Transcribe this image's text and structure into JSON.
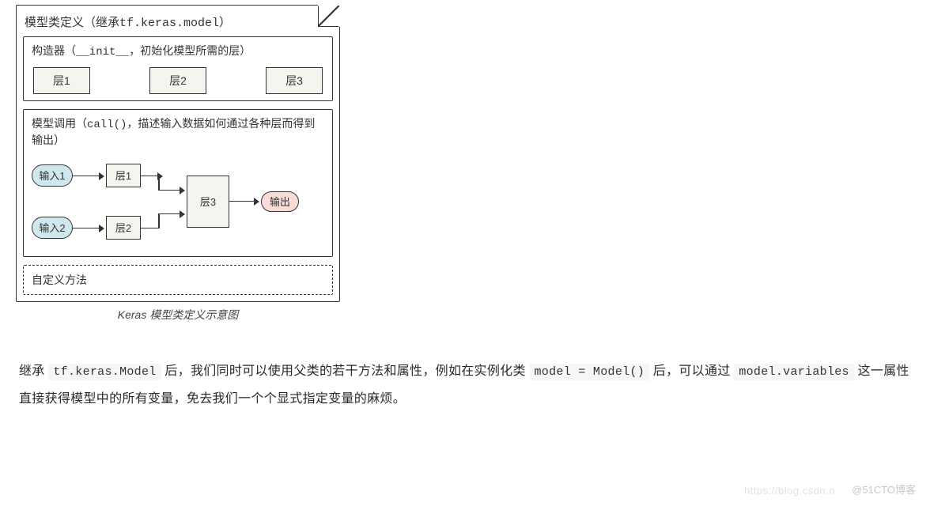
{
  "diagram": {
    "outer_title_pre": "模型类定义（继承",
    "outer_title_code": "tf.keras.model",
    "outer_title_post": "）",
    "constructor": {
      "label_pre": "构造器（",
      "label_code": "__init__",
      "label_post": "，初始化模型所需的层）",
      "layers": [
        "层1",
        "层2",
        "层3"
      ]
    },
    "call": {
      "label_pre": "模型调用（",
      "label_code": "call()",
      "label_post": "，描述输入数据如何通过各种层而得到输出）",
      "input1": "输入1",
      "input2": "输入2",
      "layer1": "层1",
      "layer2": "层2",
      "layer3": "层3",
      "output": "输出"
    },
    "custom_methods": "自定义方法",
    "caption": "Keras 模型类定义示意图"
  },
  "paragraph": {
    "t1": "继承 ",
    "c1": "tf.keras.Model",
    "t2": " 后，我们同时可以使用父类的若干方法和属性，例如在实例化类 ",
    "c2": "model = Model()",
    "t3": " 后，可以通过 ",
    "c3": "model.variables",
    "t4": " 这一属性直接获得模型中的所有变量，免去我们一个个显式指定变量的麻烦。"
  },
  "watermark": {
    "w1": "https://blog.csdn.n",
    "w2": "@51CTO博客"
  }
}
